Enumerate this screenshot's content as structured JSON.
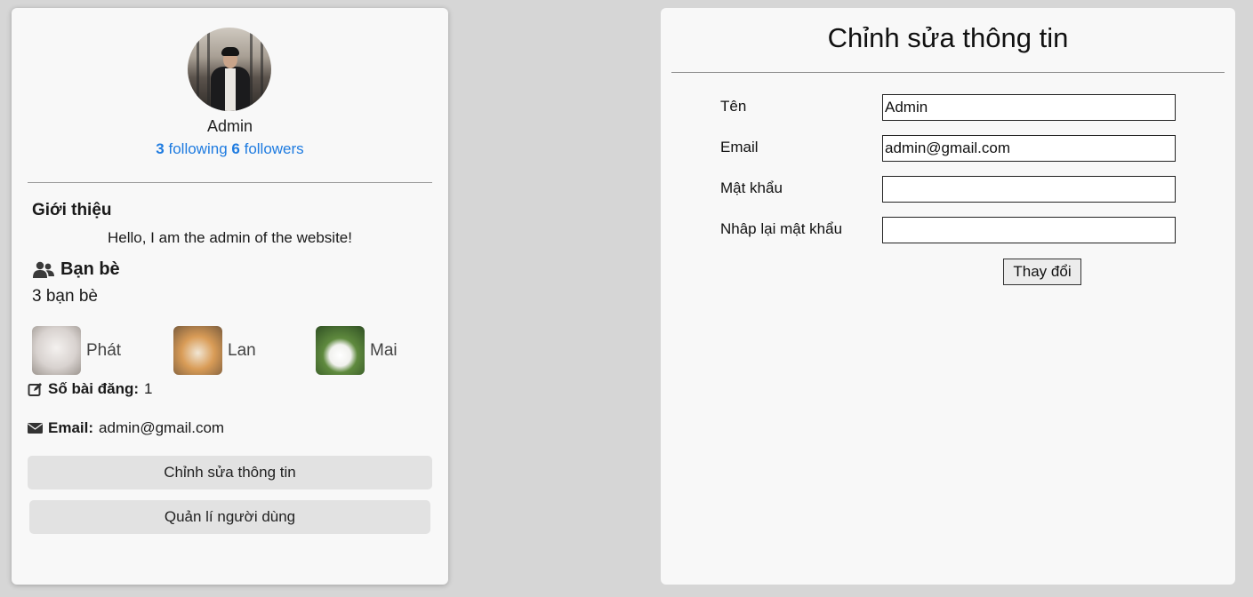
{
  "profile": {
    "name": "Admin",
    "following_count": "3",
    "following_label": "following",
    "followers_count": "6",
    "followers_label": "followers",
    "intro_title": "Giới thiệu",
    "intro_text": "Hello, I am the admin of the website!",
    "friends_title": "Bạn bè",
    "friends_count": "3 bạn bè",
    "friends": [
      {
        "name": "Phát"
      },
      {
        "name": "Lan"
      },
      {
        "name": "Mai"
      }
    ],
    "posts_label": "Số bài đăng:",
    "posts_value": "1",
    "email_label": "Email:",
    "email_value": "admin@gmail.com",
    "edit_button": "Chỉnh sửa thông tin",
    "manage_button": "Quản lí người dùng"
  },
  "form": {
    "title": "Chỉnh sửa thông tin",
    "fields": [
      {
        "label": "Tên",
        "value": "Admin"
      },
      {
        "label": "Email",
        "value": "admin@gmail.com"
      },
      {
        "label": "Mật khẩu",
        "value": ""
      },
      {
        "label": "Nhâp lại mật khẩu",
        "value": ""
      }
    ],
    "submit": "Thay đổi"
  },
  "colors": {
    "link": "#1e7be0",
    "background": "#d6d6d6",
    "card": "#f8f8f8",
    "button": "#e2e2e2"
  },
  "icons": {
    "friends": "users-icon",
    "posts": "edit-icon",
    "email": "envelope-icon"
  }
}
